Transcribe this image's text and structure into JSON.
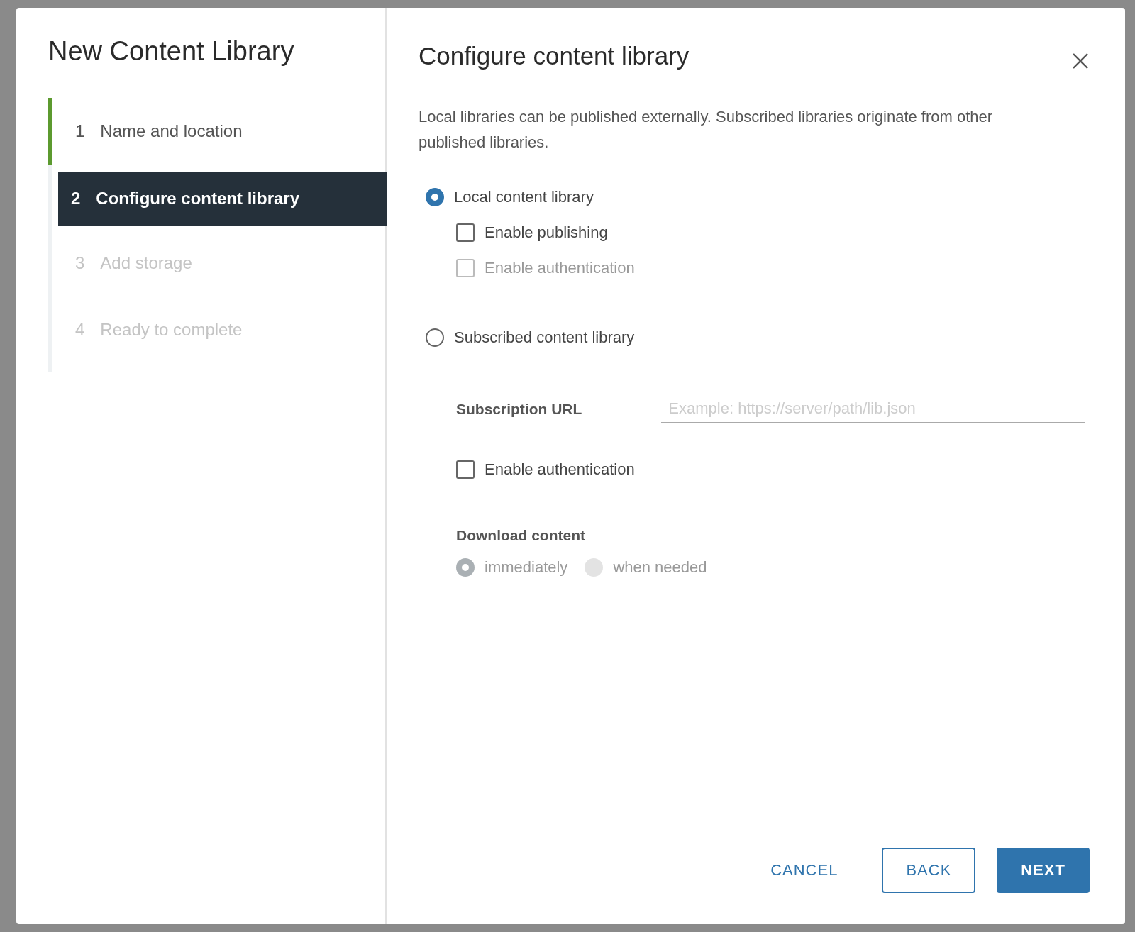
{
  "dialog": {
    "title": "New Content Library",
    "steps": [
      {
        "number": "1",
        "label": "Name and location",
        "completed": true,
        "selected": false,
        "disabled": false
      },
      {
        "number": "2",
        "label": "Configure content library",
        "completed": false,
        "selected": true,
        "disabled": false
      },
      {
        "number": "3",
        "label": "Add storage",
        "completed": false,
        "selected": false,
        "disabled": true
      },
      {
        "number": "4",
        "label": "Ready to complete",
        "completed": false,
        "selected": false,
        "disabled": true
      }
    ],
    "page_title": "Configure content library",
    "description": "Local libraries can be published externally. Subscribed libraries originate from other published libraries.",
    "local": {
      "label": "Local content library",
      "selected": true,
      "options": [
        {
          "label": "Enable publishing",
          "checked": false,
          "disabled": false
        },
        {
          "label": "Enable authentication",
          "checked": false,
          "disabled": true
        }
      ]
    },
    "subscribed": {
      "label": "Subscription URL",
      "selected": false,
      "radio_label": "Subscribed content library",
      "url_placeholder": "Example: https://server/path/lib.json",
      "authentication": {
        "label": "Enable authentication",
        "checked": false,
        "disabled": false
      },
      "download_label": "Download content",
      "download_options": [
        {
          "label": "immediately",
          "selected": true,
          "disabled": true
        },
        {
          "label": "when needed",
          "selected": false,
          "disabled": true
        }
      ]
    },
    "buttons": [
      {
        "label": "CANCEL",
        "kind": "flat"
      },
      {
        "label": "BACK",
        "kind": "outline"
      },
      {
        "label": "NEXT",
        "kind": "primary"
      }
    ]
  }
}
